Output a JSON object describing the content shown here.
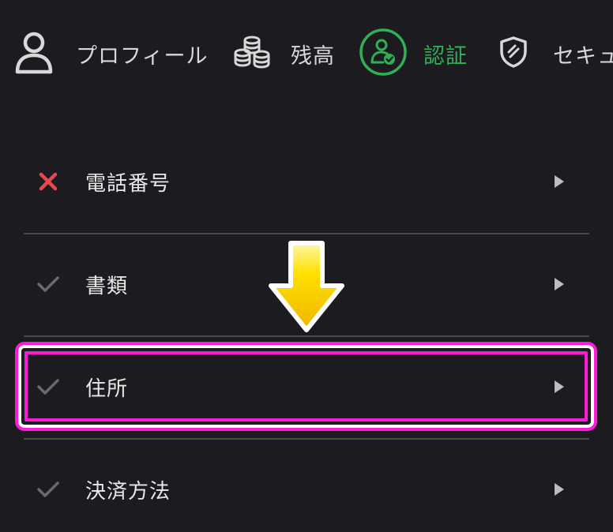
{
  "tabs": [
    {
      "label": "プロフィール",
      "icon": "user-icon",
      "active": false
    },
    {
      "label": "残高",
      "icon": "coins-icon",
      "active": false
    },
    {
      "label": "認証",
      "icon": "verified-user-icon",
      "active": true
    },
    {
      "label": "セキュ",
      "icon": "shield-icon",
      "active": false
    }
  ],
  "rows": [
    {
      "label": "電話番号",
      "status": "not-verified",
      "status_icon": "cross-icon"
    },
    {
      "label": "書類",
      "status": "verified",
      "status_icon": "check-icon"
    },
    {
      "label": "住所",
      "status": "verified",
      "status_icon": "check-icon"
    },
    {
      "label": "決済方法",
      "status": "verified",
      "status_icon": "check-icon"
    }
  ],
  "colors": {
    "background": "#1c1c20",
    "accent_green": "#2fb055",
    "error_red": "#e5484d",
    "check_gray": "#6a6a6e",
    "highlight_magenta": "#ff1ad9",
    "arrow_yellow": "#ffd400"
  }
}
